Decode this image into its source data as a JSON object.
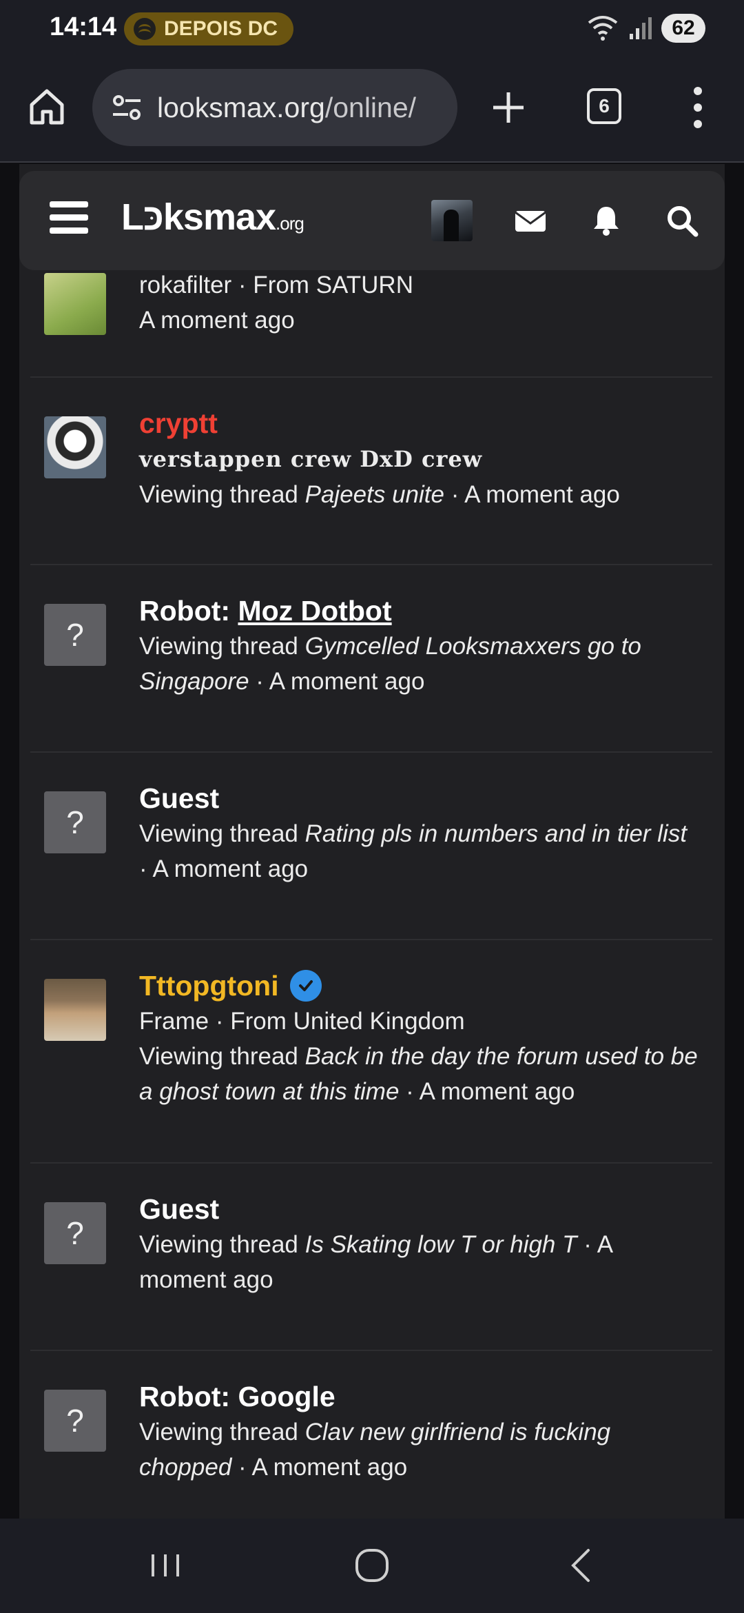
{
  "status_bar": {
    "time": "14:14",
    "media_pill": "DEPOIS DC",
    "battery": "62"
  },
  "browser": {
    "url_host": "looksmax.org",
    "url_path": "/online/",
    "tab_count": "6"
  },
  "site": {
    "logo": "Lכּksmax",
    "logo_suffix": ".org"
  },
  "rows": [
    {
      "line1": "rokafilter · From SATURN",
      "time": "A moment ago"
    },
    {
      "name": "cryptt",
      "title": "verstappen crew DxD crew",
      "prefix": "Viewing thread ",
      "thread": "Pajeets unite",
      "suffix": " · A moment ago"
    },
    {
      "name_prefix": "Robot: ",
      "name_link": "Moz Dotbot",
      "prefix": "Viewing thread ",
      "thread": "Gymcelled Looksmaxxers go to Singapore",
      "suffix": " · A moment ago"
    },
    {
      "name": "Guest",
      "prefix": "Viewing thread ",
      "thread": "Rating pls in numbers and in tier list",
      "suffix": " · A moment ago"
    },
    {
      "name": "Tttopgtoni",
      "title": "Frame · From United Kingdom",
      "prefix": "Viewing thread ",
      "thread": "Back in the day the forum used to be a ghost town at this time",
      "suffix": " · A moment ago"
    },
    {
      "name": "Guest",
      "prefix": "Viewing thread ",
      "thread": "Is Skating low T or high T",
      "suffix": " · A moment ago"
    },
    {
      "name": "Robot: Google",
      "prefix": "Viewing thread ",
      "thread": "Clav new girlfriend is fucking chopped",
      "suffix": " · A moment ago"
    }
  ],
  "guest_avatar_glyph": "?",
  "colors": {
    "accent_red": "#ef4034",
    "accent_gold": "#f2b824",
    "verified_blue": "#2f8fe6"
  }
}
